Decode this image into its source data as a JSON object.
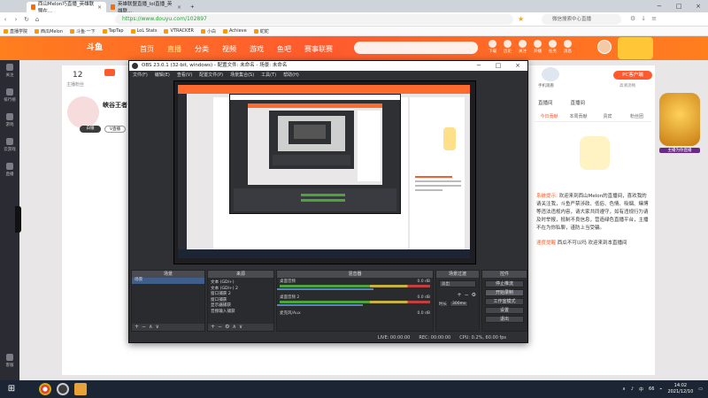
{
  "browser": {
    "tabs": [
      {
        "label": "西山Melon巧直播_英雄联盟在..."
      },
      {
        "label": "英雄联盟直播_lol直播_英雄联..."
      }
    ],
    "url": "https://www.douyu.com/102897",
    "search_placeholder": "微信搜索中心直播",
    "bookmarks": [
      "直播学院",
      "西瓜Melon",
      "斗鱼·一下",
      "TapTap",
      "LoL Stats",
      "VTRACKER",
      "小白",
      "Achieve",
      "蛇蛇"
    ]
  },
  "site": {
    "logo": "斗鱼",
    "nav": [
      "首页",
      "直播",
      "分类",
      "视频",
      "游戏",
      "鱼吧",
      "赛事联赛"
    ],
    "active_nav_index": 1,
    "header_icons": [
      "下载",
      "历史",
      "关注",
      "开播",
      "任务",
      "消息"
    ],
    "rail": [
      "关注",
      "排行榜",
      "游戏",
      "云游戏",
      "直播"
    ],
    "rail_bottom": "客服",
    "follow_count": "12",
    "follow_label": "主播粉丝",
    "streamer_name": "峡谷王者",
    "stream_title_tag": "白银",
    "stream_tag2": "V直播",
    "pc_button": "PC客户端",
    "pc_sub": "高清流畅",
    "mobile_label": "手机观看",
    "right_tabs": [
      "今日贡献",
      "本周贡献",
      "贵宾",
      "粉丝团"
    ],
    "right_top": [
      "直播间",
      "直播间"
    ],
    "chat": [
      {
        "sys": "系统提示:",
        "text": "欢迎来到西山Melon的直播间，喜欢我的请关注我，斗鱼严禁涉政、低俗、色情、吸烟、赌博等违法违规内容，请大家共同遵守，如有违规行为请及时举报，抵制不良信息，营造绿色直播平台，主播不在为你私聊，谨防上当受骗。"
      },
      {
        "sys": "速度提醒",
        "text": "西瓜不可以吗 欢迎来到本直播间"
      }
    ],
    "deco_label": "主播为你直播"
  },
  "obs": {
    "title": "OBS 23.0.1 (32-bit, windows) - 配置文件: 未命名 - 场景: 未命名",
    "menu": [
      "文件(F)",
      "编辑(E)",
      "查看(V)",
      "配置文件(P)",
      "场景集合(S)",
      "工具(T)",
      "帮助(H)"
    ],
    "docks": {
      "scenes": {
        "title": "场景",
        "items": [
          "场景"
        ]
      },
      "sources": {
        "title": "来源",
        "items": [
          "文本 (GDI+)",
          "文本 (GDI+) 2",
          "窗口捕获 2",
          "窗口捕获",
          "显示器捕获",
          "音频输入捕获"
        ]
      },
      "mixer": {
        "title": "混音器",
        "channels": [
          {
            "name": "桌面音频",
            "db": "0.0 dB",
            "level": 0.62
          },
          {
            "name": "桌面音频 2",
            "db": "0.0 dB",
            "level": 0.55
          },
          {
            "name": "麦克风/Aux",
            "db": "0.0 dB",
            "level": 0.4
          }
        ]
      },
      "transitions": {
        "title": "场景过渡",
        "type": "淡出",
        "duration_label": "时长",
        "duration": "300ms"
      },
      "controls": {
        "title": "控件",
        "buttons": [
          "停止推流",
          "开始录制",
          "工作室模式",
          "设置",
          "退出"
        ]
      }
    },
    "status": {
      "live": "LIVE: 00:00:00",
      "rec": "REC: 00:00:00",
      "cpu": "CPU: 0.2%, 60.00 fps"
    }
  },
  "taskbar": {
    "tray": {
      "lang": "中",
      "battery": "66",
      "time": "14:02",
      "date": "2021/12/10"
    }
  },
  "colors": {
    "brand": "#ff5a2e",
    "obs_bg": "#2f3034",
    "taskbar": "#1b2533"
  }
}
